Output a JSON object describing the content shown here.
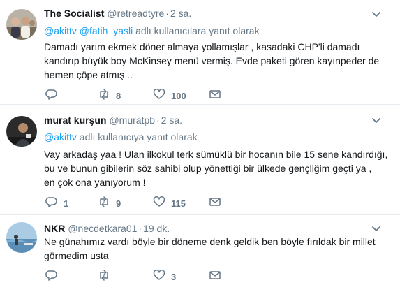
{
  "tweets": [
    {
      "name": "The Socialist",
      "handle": "@retreadtyre",
      "separator": "·",
      "time": "2 sa.",
      "reply_mentions": [
        "@akittv",
        "@fatih_yasli"
      ],
      "reply_suffix": "adlı kullanıcılara yanıt olarak",
      "text": "Damadı yarım ekmek döner almaya yollamışlar , kasadaki CHP'li damadı\nkandırıp  büyük boy McKinsey menü vermiş. Evde paketi gören kayınpeder de\nhemen çöpe atmış ..",
      "replies": "",
      "retweets": "8",
      "likes": "100"
    },
    {
      "name": "murat kurşun",
      "handle": "@muratpb",
      "separator": "·",
      "time": "2 sa.",
      "reply_mentions": [
        "@akittv"
      ],
      "reply_suffix": "adlı kullanıcıya yanıt olarak",
      "text": "Vay arkadaş yaa ! Ulan ilkokul terk sümüklü bir hocanın bile 15 sene kandırdığı,\nbu ve bunun gibilerin söz sahibi olup  yönettiği bir ülkede gençliğim geçti ya ,\nen çok ona yanıyorum !",
      "replies": "1",
      "retweets": "9",
      "likes": "115"
    },
    {
      "name": "NKR",
      "handle": "@necdetkara01",
      "separator": "·",
      "time": "19 dk.",
      "text": "Ne günahımız vardı böyle bir döneme denk geldik ben böyle fırıldak bir millet\ngörmedim usta",
      "replies": "",
      "retweets": "",
      "likes": "3"
    }
  ],
  "icons": {
    "reply": "reply-icon",
    "retweet": "retweet-icon",
    "like": "heart-icon",
    "dm": "envelope-icon",
    "caret": "chevron-down-icon"
  },
  "colors": {
    "link": "#1da1f2",
    "secondary_text": "#657786",
    "divider": "#e6ecf0"
  }
}
